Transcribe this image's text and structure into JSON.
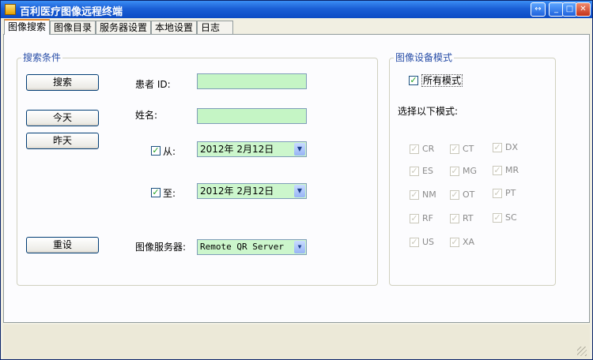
{
  "window": {
    "title": "百利医疗图像远程终端",
    "controls": {
      "restore": "↔",
      "minimize": "_",
      "maximize": "□",
      "close": "✕"
    }
  },
  "tabs": [
    "图像搜索",
    "图像目录",
    "服务器设置",
    "本地设置",
    "日志"
  ],
  "search_group": {
    "title": "搜索条件",
    "buttons": {
      "search": "搜索",
      "today": "今天",
      "yesterday": "昨天",
      "reset": "重设"
    },
    "patient_id_label": "患者 ID:",
    "patient_id_value": "",
    "name_label": "姓名:",
    "name_value": "",
    "from_label": "从:",
    "from_checked": true,
    "from_date": "2012年  2月12日",
    "to_label": "至:",
    "to_checked": true,
    "to_date": "2012年  2月12日",
    "server_label": "图像服务器:",
    "server_value": "Remote QR Server"
  },
  "modality_group": {
    "title": "图像设备模式",
    "all_label": "所有模式",
    "all_checked": true,
    "select_label": "选择以下模式:",
    "modalities": [
      "CR",
      "CT",
      "DX",
      "ES",
      "MG",
      "MR",
      "NM",
      "OT",
      "PT",
      "RF",
      "RT",
      "SC",
      "US",
      "XA"
    ]
  },
  "colors": {
    "accent": "#2a4fa8",
    "field_bg": "#c5f5c5",
    "titlebar": "#1b5fd6"
  }
}
